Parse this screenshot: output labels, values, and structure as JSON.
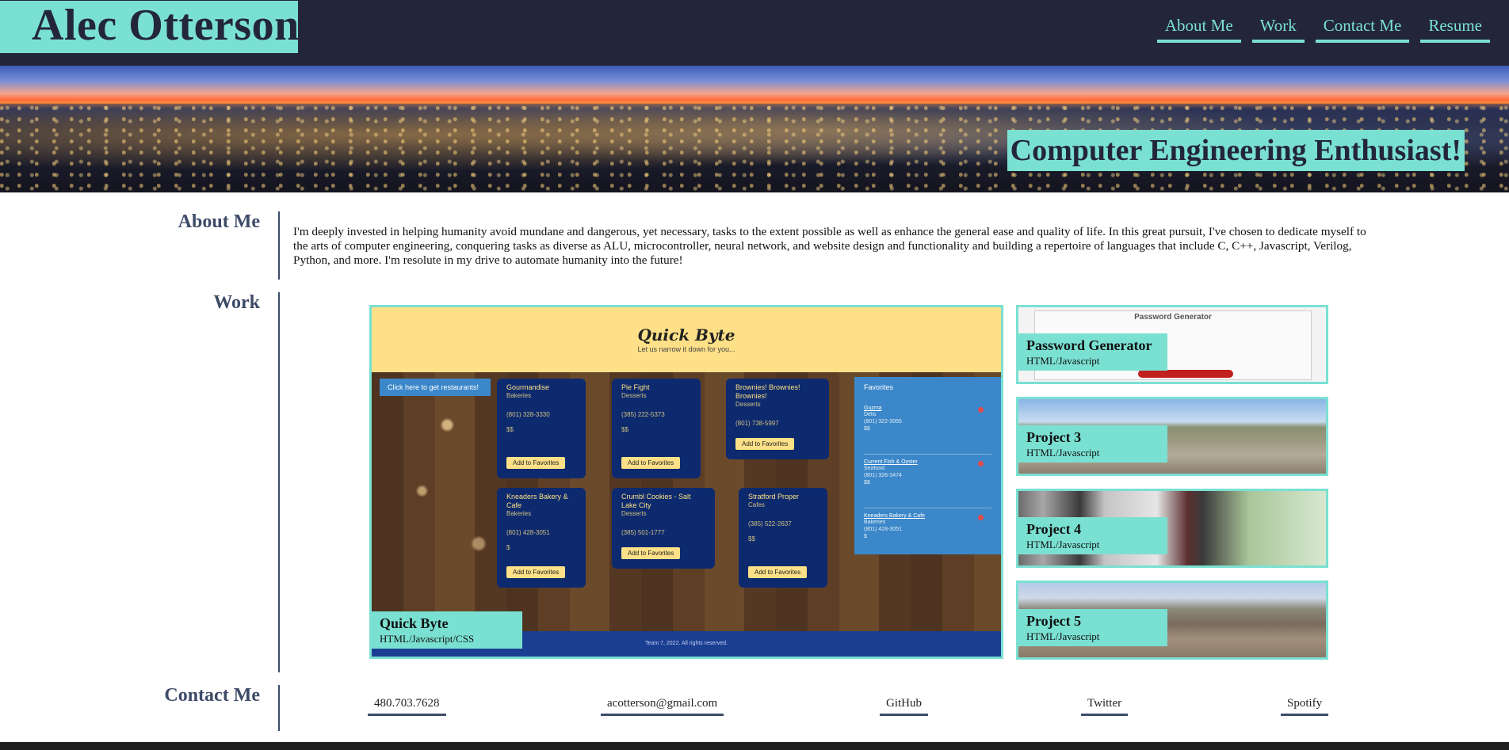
{
  "header": {
    "name": "Alec Otterson",
    "nav": [
      "About Me",
      "Work",
      "Contact Me",
      "Resume"
    ]
  },
  "hero": {
    "tagline": "Computer Engineering Enthusiast!"
  },
  "about": {
    "title": "About Me",
    "text": "I'm deeply invested in helping humanity avoid mundane and dangerous, yet necessary, tasks to the extent possible as well as enhance the general ease and quality of life. In this great pursuit, I've chosen to dedicate myself to the arts of computer engineering, conquering tasks as diverse as ALU, microcontroller, neural network, and website design and functionality and building a repertoire of languages that include C, C++, Javascript, Verilog, Python, and more. I'm resolute in my drive to automate humanity into the future!"
  },
  "work": {
    "title": "Work",
    "featured": {
      "name": "Quick Byte",
      "tech": "HTML/Javascript/CSS",
      "screenshot": {
        "logo": "Quick Byte",
        "subtitle": "Let us narrow it down for you...",
        "cta": "Click here to get restaurants!",
        "cards": [
          {
            "name": "Gourmandise",
            "category": "Bakeries",
            "phone": "(801) 328-3330",
            "price": "$$",
            "button": "Add to Favorites"
          },
          {
            "name": "Pie Fight",
            "category": "Desserts",
            "phone": "(385) 222-5373",
            "price": "$$",
            "button": "Add to Favorites"
          },
          {
            "name": "Brownies! Brownies! Brownies!",
            "category": "Desserts",
            "phone": "(801) 738-5997",
            "price": "",
            "button": "Add to Favorites"
          },
          {
            "name": "Kneaders Bakery & Cafe",
            "category": "Bakeries",
            "phone": "(801) 428-3051",
            "price": "$",
            "button": "Add to Favorites"
          },
          {
            "name": "Crumbl Cookies - Salt Lake City",
            "category": "Desserts",
            "phone": "(385) 501-1777",
            "price": "",
            "button": "Add to Favorites"
          },
          {
            "name": "Stratford Proper",
            "category": "Cafes",
            "phone": "(385) 522-2637",
            "price": "$$",
            "button": "Add to Favorites"
          }
        ],
        "favorites_title": "Favorites",
        "favorites": [
          {
            "name": "Guzma",
            "l1": "Delis",
            "l2": "(801) 322-3055",
            "l3": "$$"
          },
          {
            "name": "Current Fish & Oyster",
            "l1": "Seafood",
            "l2": "(801) 326-3474",
            "l3": "$$"
          },
          {
            "name": "Kneaders Bakery & Cafe",
            "l1": "Bakeries",
            "l2": "(801) 428-3051",
            "l3": "$"
          }
        ],
        "footer": "Team 7, 2022. All rights reserved."
      }
    },
    "projects": [
      {
        "name": "Password Generator",
        "tech": "HTML/Javascript",
        "screenshot_title": "Password Generator"
      },
      {
        "name": "Project 3",
        "tech": "HTML/Javascript"
      },
      {
        "name": "Project 4",
        "tech": "HTML/Javascript"
      },
      {
        "name": "Project 5",
        "tech": "HTML/Javascript"
      }
    ]
  },
  "contact": {
    "title": "Contact Me",
    "links": [
      "480.703.7628",
      "acotterson@gmail.com",
      "GitHub",
      "Twitter",
      "Spotify"
    ]
  },
  "colors": {
    "accent": "#7ae0d2",
    "navy": "#23263b",
    "heading": "#3d4b68"
  }
}
